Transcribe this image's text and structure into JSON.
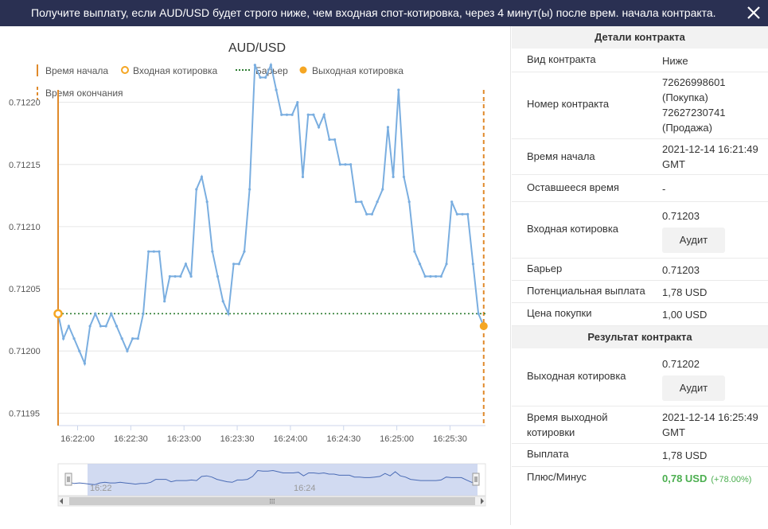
{
  "header": {
    "message": "Получите выплату, если AUD/USD будет строго ниже, чем входная спот-котировка, через 4 минут(ы) после врем. начала контракта."
  },
  "chart": {
    "title": "AUD/USD",
    "legend": {
      "start_time": "Время начала",
      "entry_spot": "Входная котировка",
      "barrier": "Барьер",
      "exit_spot": "Выходная котировка",
      "end_time": "Время окончания"
    },
    "navigator_labels": [
      "16:22",
      "16:24"
    ],
    "scroll_grip": "⁞⁞⁞"
  },
  "chart_data": {
    "type": "line",
    "title": "AUD/USD",
    "xlabel": "",
    "ylabel": "",
    "x_ticks": [
      "16:22:00",
      "16:22:30",
      "16:23:00",
      "16:23:30",
      "16:24:00",
      "16:24:30",
      "16:25:00",
      "16:25:30"
    ],
    "y_ticks": [
      "0.71195",
      "0.71200",
      "0.71205",
      "0.71210",
      "0.71215",
      "0.71220"
    ],
    "ylim": [
      0.71194,
      0.71221
    ],
    "xlim": [
      "16:21:49",
      "16:25:50"
    ],
    "grid": true,
    "legend_position": "top-left",
    "colors": {
      "line": "#7aaee0",
      "start_line": "#e08a2b",
      "barrier": "#2e7d32",
      "entry_marker": "#f5a623",
      "exit_marker": "#f5a623",
      "navigator": "#c5d1ee"
    },
    "series": [
      {
        "x": [
          "16:21:49",
          "16:21:52",
          "16:21:55",
          "16:21:58",
          "16:22:01",
          "16:22:04",
          "16:22:07",
          "16:22:10",
          "16:22:13",
          "16:22:16",
          "16:22:19",
          "16:22:22",
          "16:22:25",
          "16:22:28",
          "16:22:31",
          "16:22:34",
          "16:22:37",
          "16:22:40",
          "16:22:43",
          "16:22:46",
          "16:22:49",
          "16:22:52",
          "16:22:55",
          "16:22:58",
          "16:23:01",
          "16:23:04",
          "16:23:07",
          "16:23:10",
          "16:23:13",
          "16:23:16",
          "16:23:19",
          "16:23:22",
          "16:23:25",
          "16:23:28",
          "16:23:31",
          "16:23:34",
          "16:23:37",
          "16:23:40",
          "16:23:43",
          "16:23:46",
          "16:23:49",
          "16:23:52",
          "16:23:55",
          "16:23:58",
          "16:24:01",
          "16:24:04",
          "16:24:07",
          "16:24:10",
          "16:24:13",
          "16:24:16",
          "16:24:19",
          "16:24:22",
          "16:24:25",
          "16:24:28",
          "16:24:31",
          "16:24:34",
          "16:24:37",
          "16:24:40",
          "16:24:43",
          "16:24:46",
          "16:24:49",
          "16:24:52",
          "16:24:55",
          "16:24:58",
          "16:25:01",
          "16:25:04",
          "16:25:07",
          "16:25:10",
          "16:25:13",
          "16:25:16",
          "16:25:19",
          "16:25:22",
          "16:25:25",
          "16:25:28",
          "16:25:31",
          "16:25:34",
          "16:25:37",
          "16:25:40",
          "16:25:43",
          "16:25:46",
          "16:25:49"
        ],
        "y": [
          0.71203,
          0.71201,
          0.71202,
          0.71201,
          0.712,
          0.71199,
          0.71202,
          0.71203,
          0.71202,
          0.71202,
          0.71203,
          0.71202,
          0.71201,
          0.712,
          0.71201,
          0.71201,
          0.71203,
          0.71208,
          0.71208,
          0.71208,
          0.71204,
          0.71206,
          0.71206,
          0.71206,
          0.71207,
          0.71206,
          0.71213,
          0.71214,
          0.71212,
          0.71208,
          0.71206,
          0.71204,
          0.71203,
          0.71207,
          0.71207,
          0.71208,
          0.71213,
          0.71223,
          0.71222,
          0.71222,
          0.71223,
          0.71221,
          0.71219,
          0.71219,
          0.71219,
          0.7122,
          0.71214,
          0.71219,
          0.71219,
          0.71218,
          0.71219,
          0.71217,
          0.71217,
          0.71215,
          0.71215,
          0.71215,
          0.71212,
          0.71212,
          0.71211,
          0.71211,
          0.71212,
          0.71213,
          0.71218,
          0.71214,
          0.71221,
          0.71214,
          0.71212,
          0.71208,
          0.71207,
          0.71206,
          0.71206,
          0.71206,
          0.71206,
          0.71207,
          0.71212,
          0.71211,
          0.71211,
          0.71211,
          0.71207,
          0.71203,
          0.71202
        ]
      }
    ],
    "annotations": {
      "start_time": "16:21:49",
      "end_time": "16:25:49",
      "barrier": 0.71203,
      "entry_spot": {
        "x": "16:21:49",
        "y": 0.71203
      },
      "exit_spot": {
        "x": "16:25:49",
        "y": 0.71202
      }
    },
    "navigator": {
      "visible": true,
      "ticks": [
        "16:22",
        "16:24"
      ]
    }
  },
  "details": {
    "section1_title": "Детали контракта",
    "section2_title": "Результат контракта",
    "rows": {
      "contract_type": {
        "label": "Вид контракта",
        "value": "Ниже"
      },
      "contract_number": {
        "label": "Номер контракта",
        "lines": [
          "72626998601",
          "(Покупка)",
          "72627230741",
          "(Продажа)"
        ]
      },
      "start_time": {
        "label": "Время начала",
        "lines": [
          "2021-12-14 16:21:49",
          "GMT"
        ]
      },
      "remaining": {
        "label": "Оставшееся время",
        "value": "-"
      },
      "entry_spot": {
        "label": "Входная котировка",
        "value": "0.71203",
        "button": "Аудит"
      },
      "barrier": {
        "label": "Барьер",
        "value": "0.71203"
      },
      "potential_payout": {
        "label": "Потенциальная выплата",
        "value": "1,78 USD"
      },
      "purchase_price": {
        "label": "Цена покупки",
        "value": "1,00 USD"
      },
      "exit_spot": {
        "label": "Выходная котировка",
        "value": "0.71202",
        "button": "Аудит"
      },
      "exit_time": {
        "label_lines": [
          "Время выходной",
          "котировки"
        ],
        "lines": [
          "2021-12-14 16:25:49",
          "GMT"
        ]
      },
      "payout": {
        "label": "Выплата",
        "value": "1,78 USD"
      },
      "profit_loss": {
        "label": "Плюс/Минус",
        "value": "0,78 USD",
        "percent": "(+78.00%)"
      }
    }
  }
}
